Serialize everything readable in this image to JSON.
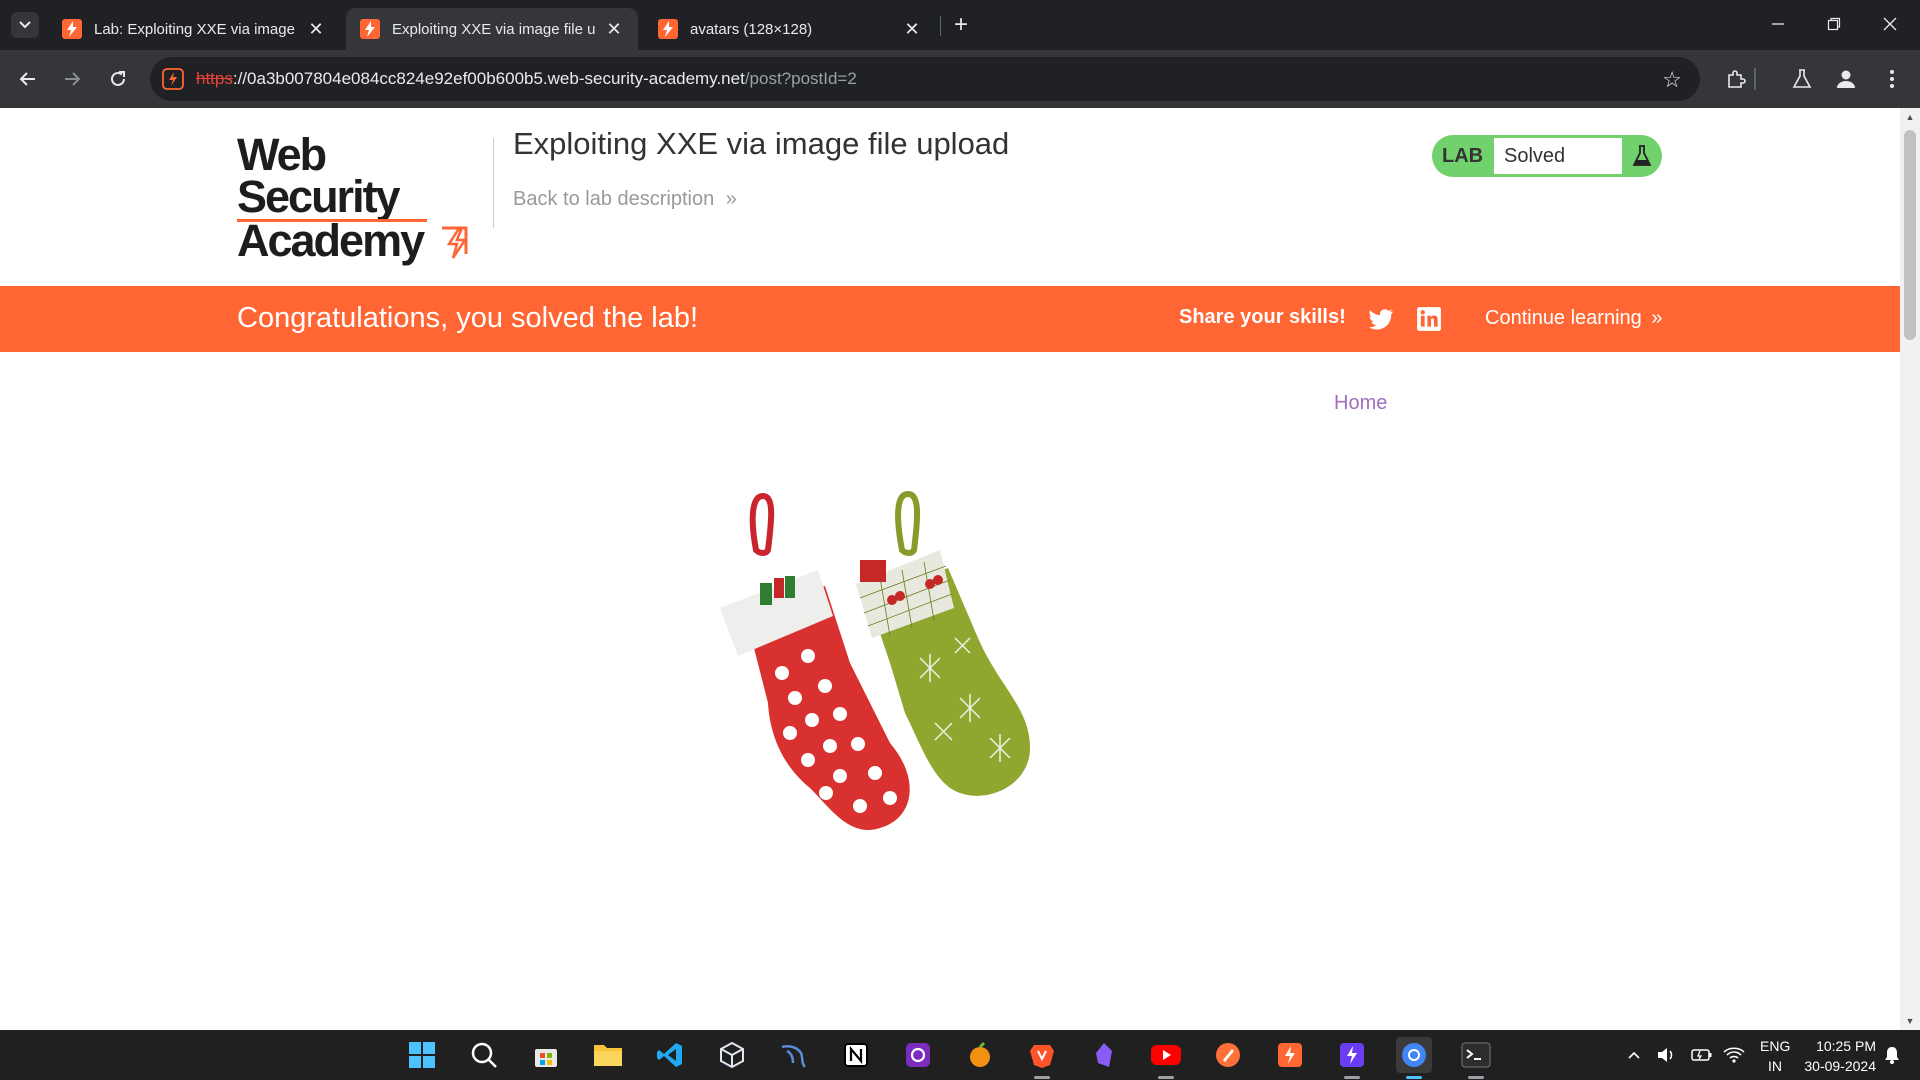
{
  "browser": {
    "tabs": [
      {
        "title": "Lab: Exploiting XXE via image fi",
        "active": false
      },
      {
        "title": "Exploiting XXE via image file up",
        "active": true
      },
      {
        "title": "avatars (128×128)",
        "active": false
      }
    ],
    "url": {
      "scheme": "https",
      "host": "://0a3b007804e084cc824e92ef00b600b5.web-security-academy.net",
      "path": "/post?postId=2"
    }
  },
  "header": {
    "logo_line1": "Web Security",
    "logo_line2": "Academy",
    "lab_title": "Exploiting XXE via image file upload",
    "back_link": "Back to lab description",
    "back_chevron": "»",
    "lab_label": "LAB",
    "lab_status": "Solved"
  },
  "banner": {
    "message": "Congratulations, you solved the lab!",
    "share": "Share your skills!",
    "continue": "Continue learning",
    "continue_chevron": "»"
  },
  "nav": {
    "home": "Home"
  },
  "taskbar": {
    "lang_line1": "ENG",
    "lang_line2": "IN",
    "time": "10:25 PM",
    "date": "30-09-2024"
  },
  "colors": {
    "brand_orange": "#ff6633",
    "lab_green": "#70d16d",
    "home_link": "#a06ebf"
  }
}
